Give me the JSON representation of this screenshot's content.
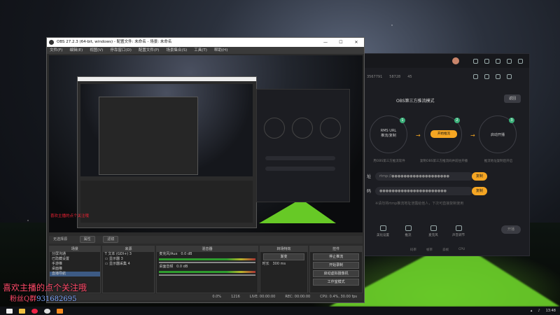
{
  "obs": {
    "title": "OBS 27.2.3 (64-bit, windows) - 配置文件: 未命名 - 场景: 未命名",
    "window_controls": [
      "—",
      "☐",
      "✕"
    ],
    "menu": [
      "文件(F)",
      "编辑(E)",
      "视图(V)",
      "停靠窗口(D)",
      "配置文件(P)",
      "场景集合(S)",
      "工具(T)",
      "帮助(H)"
    ],
    "dock_tabs": {
      "active": "无选择源",
      "properties_label": "属性",
      "filters_label": "滤镜"
    },
    "docks": {
      "scenes": {
        "title": "场景",
        "items": [
          "分屏沟通",
          "已隐藏设置",
          "手游推",
          "桌面推",
          "直播导航"
        ],
        "selected_index": 4
      },
      "sources": {
        "title": "来源",
        "items": [
          "文本 (GDI+) 3",
          "显示器 3",
          "显示器采集 4"
        ]
      },
      "mixer": {
        "title": "混音器",
        "channels": [
          {
            "name": "麦克风/Aux",
            "db": "0.0 dB"
          },
          {
            "name": "桌面音频",
            "db": "0.0 dB"
          }
        ]
      },
      "transitions": {
        "title": "转场特效",
        "type": "渐变",
        "duration_label": "时长",
        "duration": "300 ms"
      },
      "controls": {
        "title": "控件",
        "buttons": [
          "停止推流",
          "开始录制",
          "启动虚拟摄像机",
          "工作室模式",
          "设置",
          "退出"
        ]
      }
    },
    "status": {
      "live": "LIVE: 00:00:00",
      "rec": "REC: 00:00:00",
      "cpu": "CPU: 0.4%, 30.00 fps",
      "drop": "0.0%",
      "bitrate": "1216"
    }
  },
  "overlay": {
    "line1": "喜欢主播的点个关注哦",
    "line2_prefix": "粉丝Q群",
    "line2_number": "931682695"
  },
  "companion": {
    "account": "",
    "sub_items": [
      "3567791",
      "58728",
      "45"
    ],
    "header": "OBS第三方推流模式",
    "back_button": "返回",
    "steps": [
      {
        "num": "1",
        "label": "RMS URL",
        "sub": "推流/复制"
      },
      {
        "num": "2",
        "label": "开始推流"
      },
      {
        "num": "3",
        "label": "启动开播"
      }
    ],
    "step_captions": [
      "用OBS第三方推流软件",
      "复制OBS第三方推流码并前往开播",
      "推流地址复制后开启"
    ],
    "fields": [
      {
        "label": "址",
        "value": "rtmp://●●●●●●●●●●●●●●●●●●●",
        "button": "复制"
      },
      {
        "label": "码",
        "value": "●●●●●●●●●●●●●●●●●●●●●●",
        "button": "复制"
      }
    ],
    "note": "※请勿将rtmp推流地址泄露给他人，下次可直接复制使用",
    "tools": [
      "美化设置",
      "推流",
      "麦克风",
      "声音调节"
    ],
    "live_button": "开播",
    "stats": [
      "码率",
      "帧率",
      "丢帧",
      "CPU"
    ]
  },
  "taskbar": {
    "time": "13:48"
  }
}
